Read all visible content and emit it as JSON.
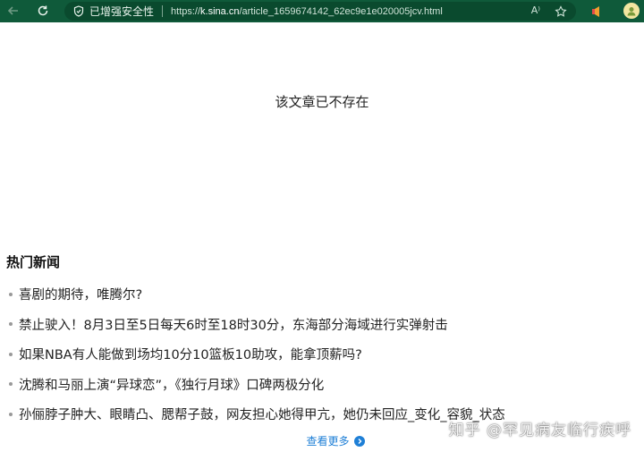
{
  "browser": {
    "security_label": "已增强安全性",
    "url_prefix": "https://",
    "url_host": "k.sina.cn",
    "url_path": "/article_1659674142_62ec9e1e020005jcv.html",
    "reader_label": "A⁾"
  },
  "page": {
    "notice": "该文章已不存在",
    "hot_title": "热门新闻",
    "news": [
      "喜剧的期待，唯腾尔?",
      "禁止驶入！8月3日至5日每天6时至18时30分，东海部分海域进行实弹射击",
      "如果NBA有人能做到场均10分10篮板10助攻，能拿顶薪吗?",
      "沈腾和马丽上演“异球恋”，《独行月球》口碑两极分化",
      "孙俪脖子肿大、眼睛凸、腮帮子鼓，网友担心她得甲亢，她仍未回应_变化_容貌_状态"
    ],
    "more_label": "查看更多"
  },
  "watermark": "知乎 @罕见病友临行疾呼",
  "colors": {
    "toolbar": "#0f5a3a",
    "link": "#1e7fd6"
  }
}
